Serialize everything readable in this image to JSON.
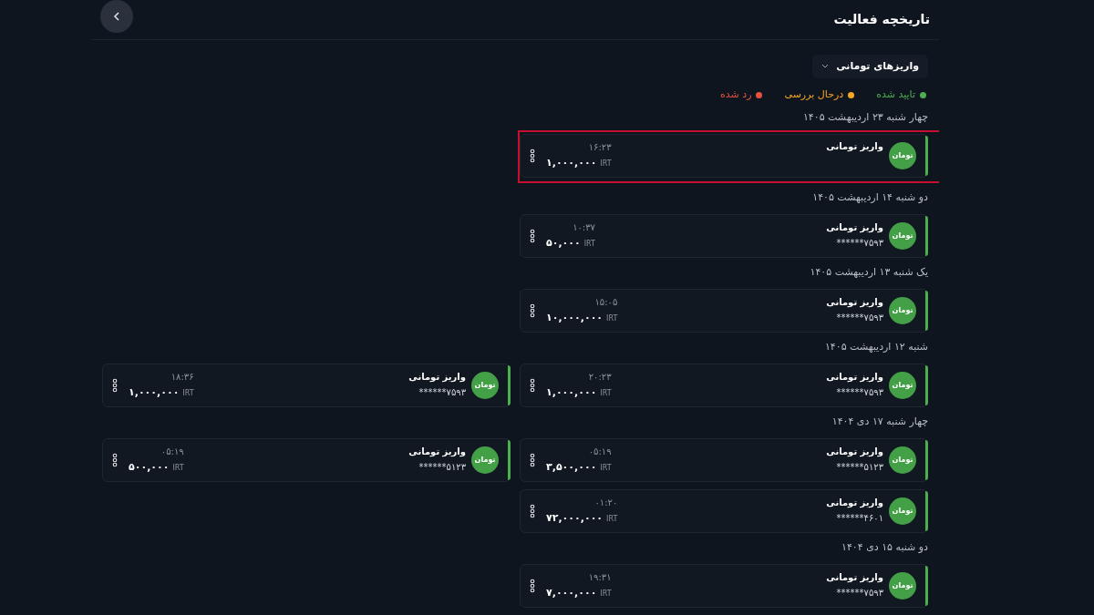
{
  "header": {
    "title": "تاریخچه فعالیت"
  },
  "filter": {
    "label": "واریزهای تومانی"
  },
  "legend": [
    {
      "label": "تایید شده",
      "color": "#4caf50"
    },
    {
      "label": "درحال بررسی",
      "color": "#f5a623"
    },
    {
      "label": "رد شده",
      "color": "#e5533d"
    }
  ],
  "groups": [
    {
      "date": "چهار شنبه ۲۳ اردیبهشت ۱۴۰۵",
      "cards": [
        {
          "title": "واریز تومانی",
          "badge": "تومان",
          "time": "۱۶:۲۳",
          "amount": "۱,۰۰۰,۰۰۰",
          "currency": "IRT",
          "color": "#4caf50",
          "highlighted": true
        }
      ]
    },
    {
      "date": "دو شنبه ۱۴ اردیبهشت ۱۴۰۵",
      "cards": [
        {
          "title": "واریز تومانی",
          "badge": "تومان",
          "account": "******۷۵۹۳",
          "time": "۱۰:۳۷",
          "amount": "۵۰,۰۰۰",
          "currency": "IRT",
          "color": "#4caf50",
          "highlighted": false
        }
      ]
    },
    {
      "date": "یک شنبه ۱۳ اردیبهشت ۱۴۰۵",
      "cards": [
        {
          "title": "واریز تومانی",
          "badge": "تومان",
          "account": "******۷۵۹۳",
          "time": "۱۵:۰۵",
          "amount": "۱۰,۰۰۰,۰۰۰",
          "currency": "IRT",
          "color": "#4caf50",
          "highlighted": false
        }
      ]
    },
    {
      "date": "شنبه ۱۲ اردیبهشت ۱۴۰۵",
      "cards": [
        {
          "title": "واریز تومانی",
          "badge": "تومان",
          "account": "******۷۵۹۳",
          "time": "۲۰:۲۳",
          "amount": "۱,۰۰۰,۰۰۰",
          "currency": "IRT",
          "color": "#4caf50",
          "highlighted": false
        },
        {
          "title": "واریز تومانی",
          "badge": "تومان",
          "account": "******۷۵۹۳",
          "time": "۱۸:۳۶",
          "amount": "۱,۰۰۰,۰۰۰",
          "currency": "IRT",
          "color": "#4caf50",
          "highlighted": false
        }
      ]
    },
    {
      "date": "چهار شنبه ۱۷ دی ۱۴۰۴",
      "cards": [
        {
          "title": "واریز تومانی",
          "badge": "تومان",
          "account": "******۵۱۲۳",
          "time": "۰۵:۱۹",
          "amount": "۳,۵۰۰,۰۰۰",
          "currency": "IRT",
          "color": "#4caf50",
          "highlighted": false
        },
        {
          "title": "واریز تومانی",
          "badge": "تومان",
          "account": "******۵۱۲۳",
          "time": "۰۵:۱۹",
          "amount": "۵۰۰,۰۰۰",
          "currency": "IRT",
          "color": "#4caf50",
          "highlighted": false
        },
        {
          "title": "واریز تومانی",
          "badge": "تومان",
          "account": "******۴۶۰۱",
          "time": "۰۱:۲۰",
          "amount": "۷۲,۰۰۰,۰۰۰",
          "currency": "IRT",
          "color": "#4caf50",
          "highlighted": false
        }
      ]
    },
    {
      "date": "دو شنبه ۱۵ دی ۱۴۰۴",
      "cards": [
        {
          "title": "واریز تومانی",
          "badge": "تومان",
          "account": "******۷۵۹۳",
          "time": "۱۹:۳۱",
          "amount": "۷,۰۰۰,۰۰۰",
          "currency": "IRT",
          "color": "#4caf50",
          "highlighted": false
        }
      ]
    }
  ]
}
